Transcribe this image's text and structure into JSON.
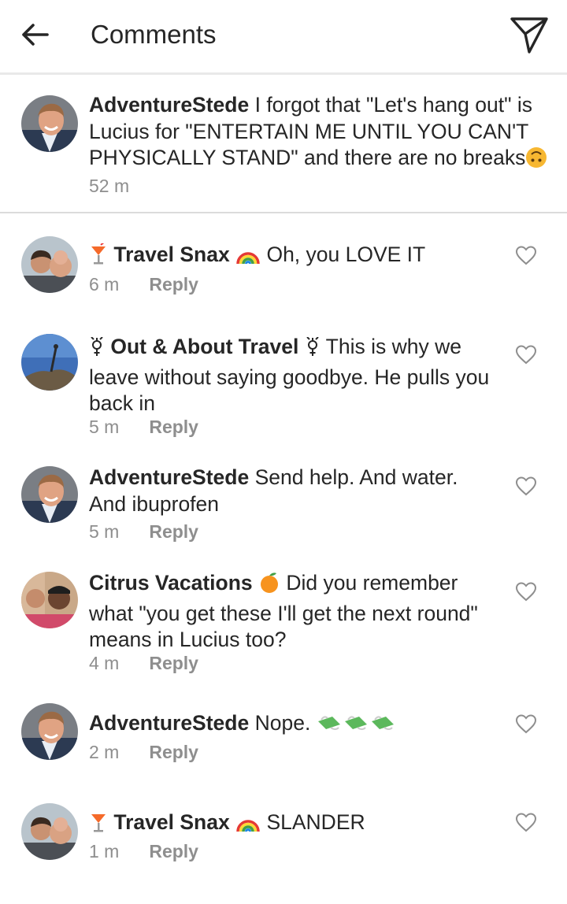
{
  "header": {
    "title": "Comments",
    "back_icon": "arrow-left-icon",
    "send_icon": "paper-plane-icon"
  },
  "caption": {
    "username": "AdventureStede",
    "text": "I forgot that \"Let's hang out\" is Lucius for \"ENTERTAIN ME UNTIL YOU CAN'T PHYSICALLY STAND\" and there are no breaks",
    "emoji": "🙃",
    "time": "52 m"
  },
  "comments": [
    {
      "username": "Travel Snax",
      "prefix": "🍹",
      "suffix": "🌈",
      "text": "Oh, you LOVE IT",
      "time": "6 m",
      "reply": "Reply"
    },
    {
      "username": "Out & About Travel",
      "prefix": "⚥",
      "suffix": "⚥",
      "text": "This is why we leave without saying goodbye. He pulls you back in",
      "time": "5 m",
      "reply": "Reply"
    },
    {
      "username": "AdventureStede",
      "text": "Send help. And water. And ibuprofen",
      "time": "5 m",
      "reply": "Reply"
    },
    {
      "username": "Citrus Vacations",
      "suffix": "🍊",
      "text": "Did you remember what \"you get these I'll get the next round\" means in Lucius too?",
      "time": "4 m",
      "reply": "Reply"
    },
    {
      "username": "AdventureStede",
      "text": "Nope.",
      "trailing": "💸💸💸",
      "time": "2 m",
      "reply": "Reply"
    },
    {
      "username": "Travel Snax",
      "prefix": "🍹",
      "suffix": "🌈",
      "text": "SLANDER",
      "time": "1 m",
      "reply": "Reply"
    }
  ],
  "colors": {
    "text": "#262626",
    "secondary": "#8e8e8e",
    "divider": "#dbdbdb"
  }
}
